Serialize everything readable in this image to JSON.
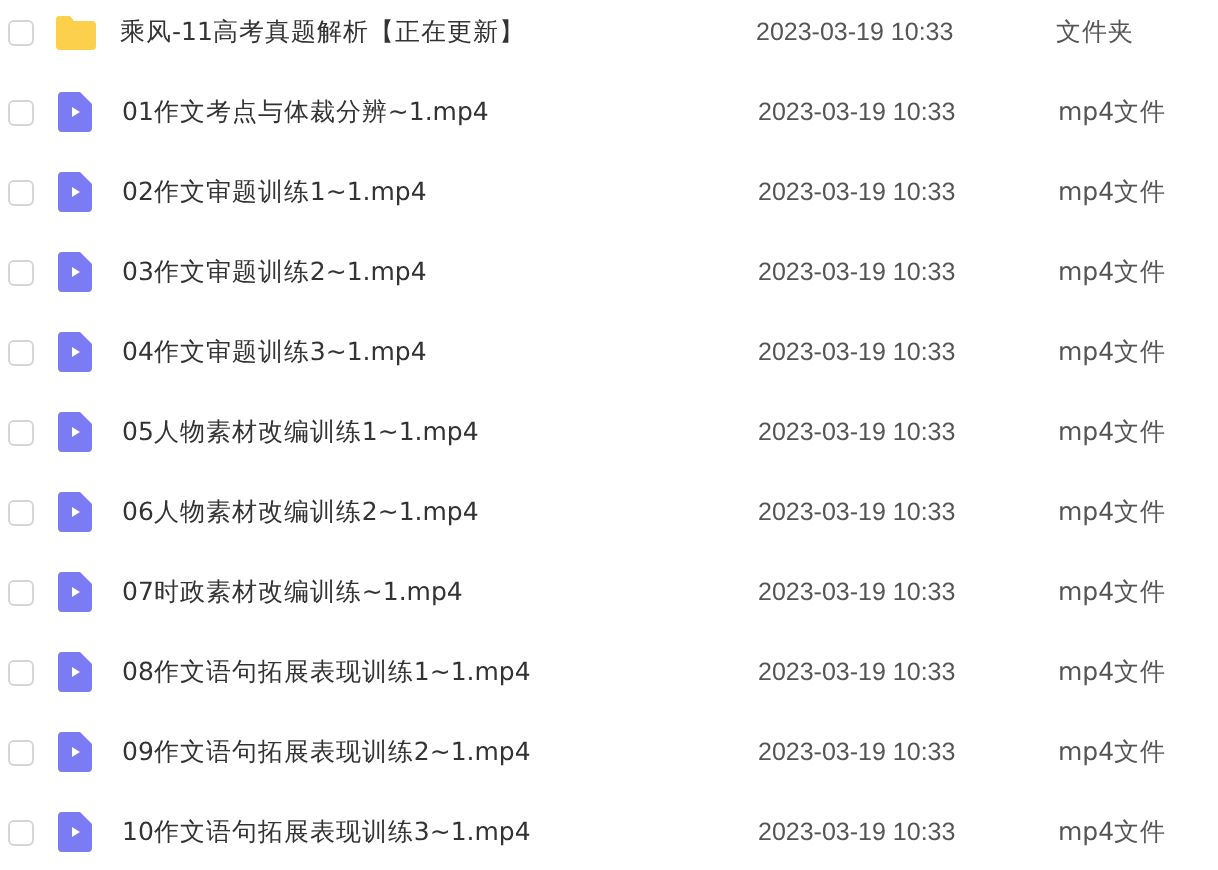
{
  "files": [
    {
      "kind": "folder",
      "name": "乘风-11高考真题解析【正在更新】",
      "date": "2023-03-19 10:33",
      "type": "文件夹",
      "checked": false
    },
    {
      "kind": "video",
      "name": "01作文考点与体裁分辨~1.mp4",
      "date": "2023-03-19 10:33",
      "type": "mp4文件",
      "checked": false
    },
    {
      "kind": "video",
      "name": "02作文审题训练1~1.mp4",
      "date": "2023-03-19 10:33",
      "type": "mp4文件",
      "checked": false
    },
    {
      "kind": "video",
      "name": "03作文审题训练2~1.mp4",
      "date": "2023-03-19 10:33",
      "type": "mp4文件",
      "checked": false
    },
    {
      "kind": "video",
      "name": "04作文审题训练3~1.mp4",
      "date": "2023-03-19 10:33",
      "type": "mp4文件",
      "checked": false
    },
    {
      "kind": "video",
      "name": "05人物素材改编训练1~1.mp4",
      "date": "2023-03-19 10:33",
      "type": "mp4文件",
      "checked": false
    },
    {
      "kind": "video",
      "name": "06人物素材改编训练2~1.mp4",
      "date": "2023-03-19 10:33",
      "type": "mp4文件",
      "checked": false
    },
    {
      "kind": "video",
      "name": "07时政素材改编训练~1.mp4",
      "date": "2023-03-19 10:33",
      "type": "mp4文件",
      "checked": false
    },
    {
      "kind": "video",
      "name": "08作文语句拓展表现训练1~1.mp4",
      "date": "2023-03-19 10:33",
      "type": "mp4文件",
      "checked": false
    },
    {
      "kind": "video",
      "name": "09作文语句拓展表现训练2~1.mp4",
      "date": "2023-03-19 10:33",
      "type": "mp4文件",
      "checked": false
    },
    {
      "kind": "video",
      "name": "10作文语句拓展表现训练3~1.mp4",
      "date": "2023-03-19 10:33",
      "type": "mp4文件",
      "checked": false
    }
  ]
}
